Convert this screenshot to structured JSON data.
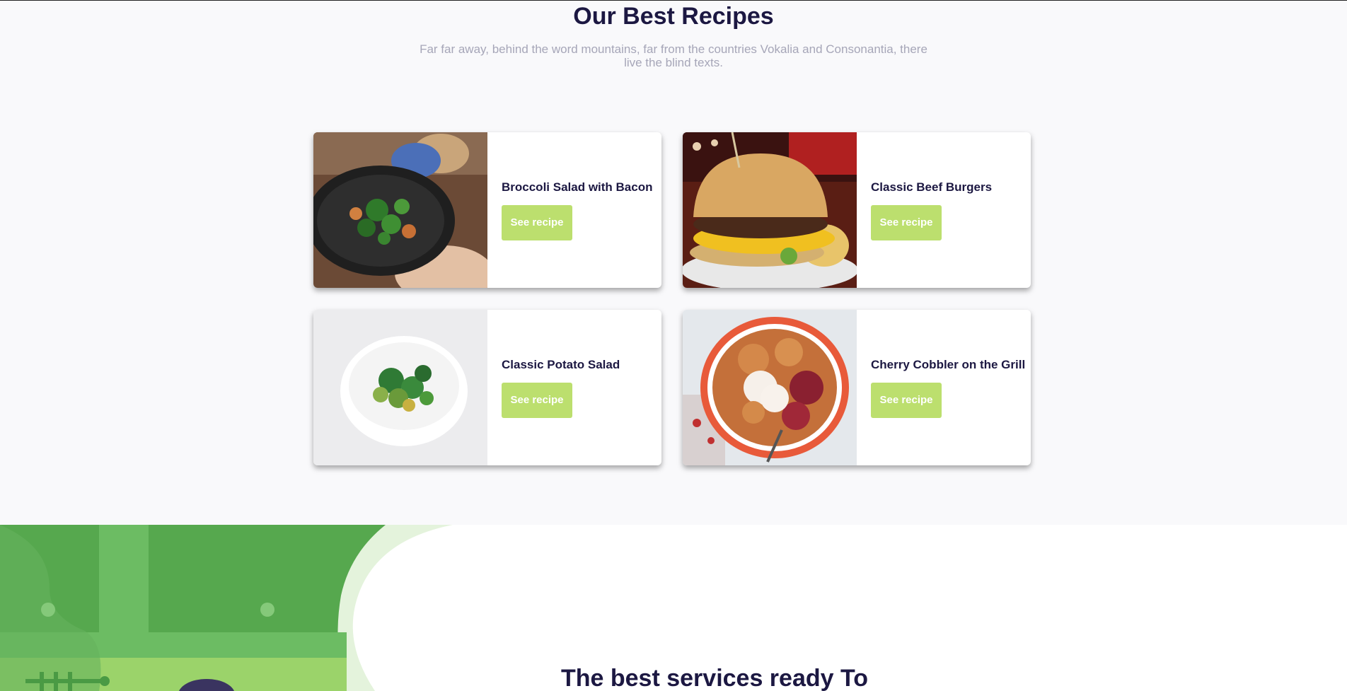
{
  "header": {
    "title": "Our Best Recipes",
    "subtitle": "Far far away, behind the word mountains, far from the countries Vokalia and Consonantia, there live the blind texts."
  },
  "recipes": [
    {
      "title": "Broccoli Salad with Bacon",
      "button": "See recipe",
      "image": "broccoli-bowl-photo"
    },
    {
      "title": "Classic Beef Burgers",
      "button": "See recipe",
      "image": "burger-photo"
    },
    {
      "title": "Classic Potato Salad",
      "button": "See recipe",
      "image": "salad-bowl-photo"
    },
    {
      "title": "Cherry Cobbler on the Grill",
      "button": "See recipe",
      "image": "cobbler-photo"
    }
  ],
  "services": {
    "title": "The best services ready To"
  },
  "colors": {
    "heading": "#1c1842",
    "subtitle": "#a6a6b8",
    "button": "#bcdf6e",
    "illustration_green": "#56a84e"
  }
}
